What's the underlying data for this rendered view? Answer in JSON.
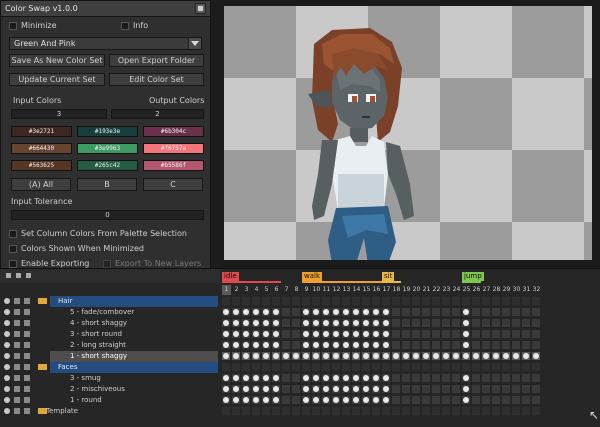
{
  "dialog": {
    "title": "Color Swap v1.0.0",
    "minimize_label": "Minimize",
    "info_label": "Info",
    "preset": "Green And Pink",
    "save_new_label": "Save As New Color Set",
    "open_export_label": "Open Export Folder",
    "update_label": "Update Current Set",
    "edit_label": "Edit Color Set",
    "input_colors_label": "Input Colors",
    "output_colors_label": "Output Colors",
    "input_colors_value": "3",
    "output_colors_value": "2",
    "swatches": [
      {
        "hex": "#3e2721",
        "color": "#3e2721"
      },
      {
        "hex": "#193e3e",
        "color": "#193e3e"
      },
      {
        "hex": "#6b304c",
        "color": "#6b304c"
      },
      {
        "hex": "#664430",
        "color": "#664430"
      },
      {
        "hex": "#3e9963",
        "color": "#3e9963"
      },
      {
        "hex": "#f6757a",
        "color": "#f6757a"
      },
      {
        "hex": "#563625",
        "color": "#563625"
      },
      {
        "hex": "#265c42",
        "color": "#265c42"
      },
      {
        "hex": "#b5586f",
        "color": "#b5586f"
      }
    ],
    "col_a_label": "(A) All",
    "col_b_label": "B",
    "col_c_label": "C",
    "tolerance_label": "Input Tolerance",
    "tolerance_value": "0",
    "set_column_label": "Set Column Colors From Palette Selection",
    "colors_shown_label": "Colors Shown When Minimized",
    "enable_export_label": "Enable Exporting",
    "export_layers_label": "Export To New Layers"
  },
  "timeline": {
    "tags": [
      {
        "name": "idle",
        "color": "#e04a4a"
      },
      {
        "name": "walk",
        "color": "#f0a030"
      },
      {
        "name": "sit",
        "color": "#e8b84a"
      },
      {
        "name": "jump",
        "color": "#7ec850"
      }
    ],
    "frame_numbers": [
      "1",
      "2",
      "3",
      "4",
      "5",
      "6",
      "7",
      "8",
      "9",
      "10",
      "11",
      "12",
      "13",
      "14",
      "15",
      "16",
      "17",
      "18",
      "19",
      "20",
      "21",
      "22",
      "23",
      "24",
      "25",
      "26",
      "27",
      "28",
      "29",
      "30",
      "31",
      "32"
    ],
    "layers": [
      {
        "name": "Hair",
        "type": "group"
      },
      {
        "name": "5 - fade/combover",
        "type": "layer"
      },
      {
        "name": "4 - short shaggy",
        "type": "layer"
      },
      {
        "name": "3 - short round",
        "type": "layer"
      },
      {
        "name": "2 - long straight",
        "type": "layer"
      },
      {
        "name": "1 - short shaggy",
        "type": "sel"
      },
      {
        "name": "Faces",
        "type": "group"
      },
      {
        "name": "3 - smug",
        "type": "layer"
      },
      {
        "name": "2 - mischiveous",
        "type": "layer"
      },
      {
        "name": "1 - round",
        "type": "layer"
      },
      {
        "name": "Template",
        "type": "folder"
      }
    ]
  }
}
